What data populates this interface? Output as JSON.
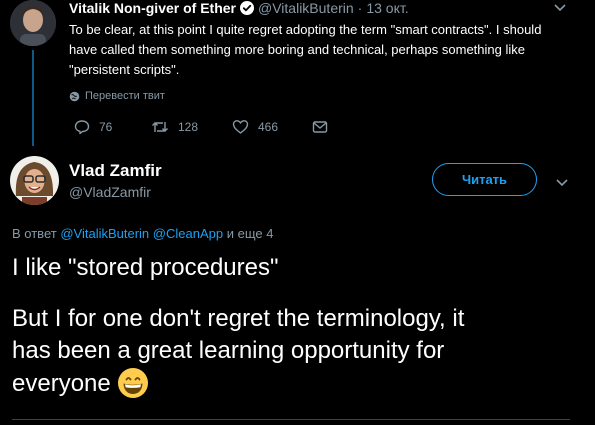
{
  "parent_tweet": {
    "display_name": "Vitalik Non-giver of Ether",
    "handle": "@VitalikButerin",
    "separator": "·",
    "date": "13 окт.",
    "text": "To be clear, at this point I quite regret adopting the term \"smart contracts\". I should have called them something more boring and technical, perhaps something like \"persistent scripts\".",
    "translate_label": "Перевести твит",
    "actions": {
      "replies": "76",
      "retweets": "128",
      "likes": "466"
    }
  },
  "main_tweet": {
    "display_name": "Vlad Zamfir",
    "handle": "@VladZamfir",
    "follow_label": "Читать",
    "reply_to": {
      "prefix": "В ответ",
      "mention_1": "@VitalikButerin",
      "mention_2": "@CleanApp",
      "suffix": "и еще 4"
    },
    "text_lines": [
      "I like \"stored procedures\"",
      "But I for one don't regret the terminology, it",
      "has been a great learning opportunity for",
      "everyone"
    ],
    "emoji": "grinning-face-icon"
  },
  "colors": {
    "background": "#000000",
    "accent": "#1da1f2",
    "secondary_text": "#8899a6",
    "primary_text": "#ffffff"
  }
}
